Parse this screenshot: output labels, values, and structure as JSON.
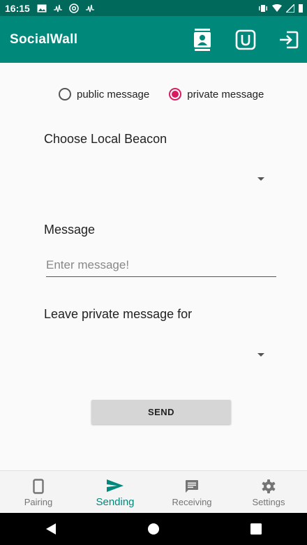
{
  "status_bar": {
    "time": "16:15"
  },
  "app_bar": {
    "title": "SocialWall"
  },
  "radio": {
    "public_label": "public message",
    "private_label": "private message",
    "selected": "private message"
  },
  "beacon_section": {
    "label": "Choose Local Beacon"
  },
  "message_section": {
    "label": "Message",
    "placeholder": "Enter message!",
    "value": ""
  },
  "recipient_section": {
    "label": "Leave private message for"
  },
  "send_button": {
    "label": "SEND"
  },
  "bottom_nav": {
    "items": [
      {
        "label": "Pairing",
        "icon": "phone-icon"
      },
      {
        "label": "Sending",
        "icon": "send-icon"
      },
      {
        "label": "Receiving",
        "icon": "message-icon"
      },
      {
        "label": "Settings",
        "icon": "gear-icon"
      }
    ],
    "active": "Sending"
  },
  "colors": {
    "primary": "#00897b",
    "primary_dark": "#00695c",
    "accent": "#d81b60"
  }
}
